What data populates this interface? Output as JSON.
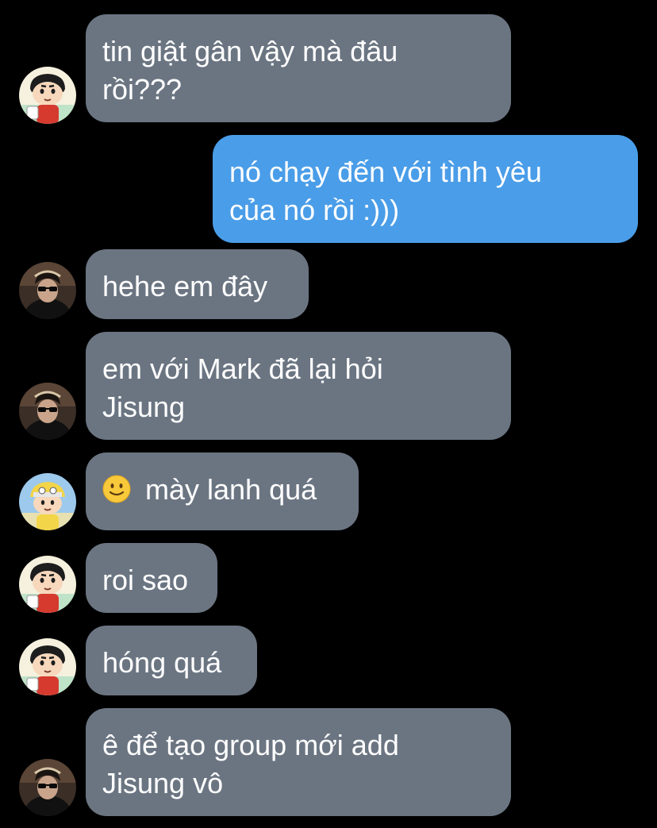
{
  "colors": {
    "background": "#000000",
    "incoming_bubble": "#6b7582",
    "outgoing_bubble": "#4a9de8",
    "text": "#ffffff"
  },
  "messages": [
    {
      "direction": "incoming",
      "avatar": "cartoon-boy-avatar",
      "text_lines": [
        "tin giật gân vậy mà đâu",
        "rồi???"
      ]
    },
    {
      "direction": "outgoing",
      "text_lines": [
        "nó chạy đến với tình yêu",
        "của nó rồi :)))"
      ]
    },
    {
      "direction": "incoming",
      "avatar": "person-sunglasses-avatar",
      "text_lines": [
        "hehe em đây"
      ]
    },
    {
      "direction": "incoming",
      "avatar": "person-sunglasses-avatar",
      "text_lines": [
        "em với Mark đã lại hỏi",
        "Jisung"
      ]
    },
    {
      "direction": "incoming",
      "avatar": "cartoon-boy-hat-avatar",
      "emoji": "slightly-smiling-face-icon",
      "text_lines": [
        "mày lanh quá"
      ]
    },
    {
      "direction": "incoming",
      "avatar": "cartoon-boy-avatar",
      "text_lines": [
        "roi sao"
      ]
    },
    {
      "direction": "incoming",
      "avatar": "cartoon-boy-avatar",
      "text_lines": [
        "hóng quá"
      ]
    },
    {
      "direction": "incoming",
      "avatar": "person-sunglasses-avatar",
      "text_lines": [
        "ê để tạo group mới add",
        "Jisung vô"
      ]
    }
  ]
}
